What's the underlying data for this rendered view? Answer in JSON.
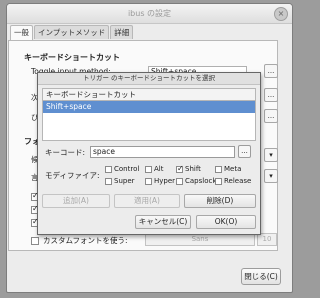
{
  "window": {
    "title": "ibus の設定",
    "close_glyph": "×"
  },
  "tabs": [
    {
      "label": "一般",
      "active": true
    },
    {
      "label": "インプットメソッド"
    },
    {
      "label": "詳細"
    }
  ],
  "section_keyboard": "キーボードショートカット",
  "toggle_label": "Toggle input method:",
  "toggle_value": "Shift+space",
  "next_label": "次",
  "prev_label": "ひ",
  "font_section": "フォ",
  "side_labels": [
    "候補",
    "言語"
  ],
  "custom_font_label": "カスタムフォントを使う:",
  "font_name": "Sans",
  "font_size": "10",
  "close_button": "閉じる(C)",
  "dialog": {
    "title": "トリガー のキーボードショートカットを選択",
    "list_header": "キーボードショートカット",
    "selected_item": "Shift+space",
    "keycode_label": "キーコード:",
    "keycode_value": "space",
    "dots": "...",
    "modifier_label": "モディファイア:",
    "modifiers": [
      {
        "label": "Control",
        "checked": false
      },
      {
        "label": "Alt",
        "checked": false
      },
      {
        "label": "Shift",
        "checked": true
      },
      {
        "label": "Meta",
        "checked": false
      },
      {
        "label": "Super",
        "checked": false
      },
      {
        "label": "Hyper",
        "checked": false
      },
      {
        "label": "Capslock",
        "checked": false
      },
      {
        "label": "Release",
        "checked": false
      }
    ],
    "add_button": "追加(A)",
    "apply_button": "適用(A)",
    "delete_button": "削除(D)",
    "cancel_button": "キャンセル(C)",
    "ok_button": "OK(O)"
  }
}
